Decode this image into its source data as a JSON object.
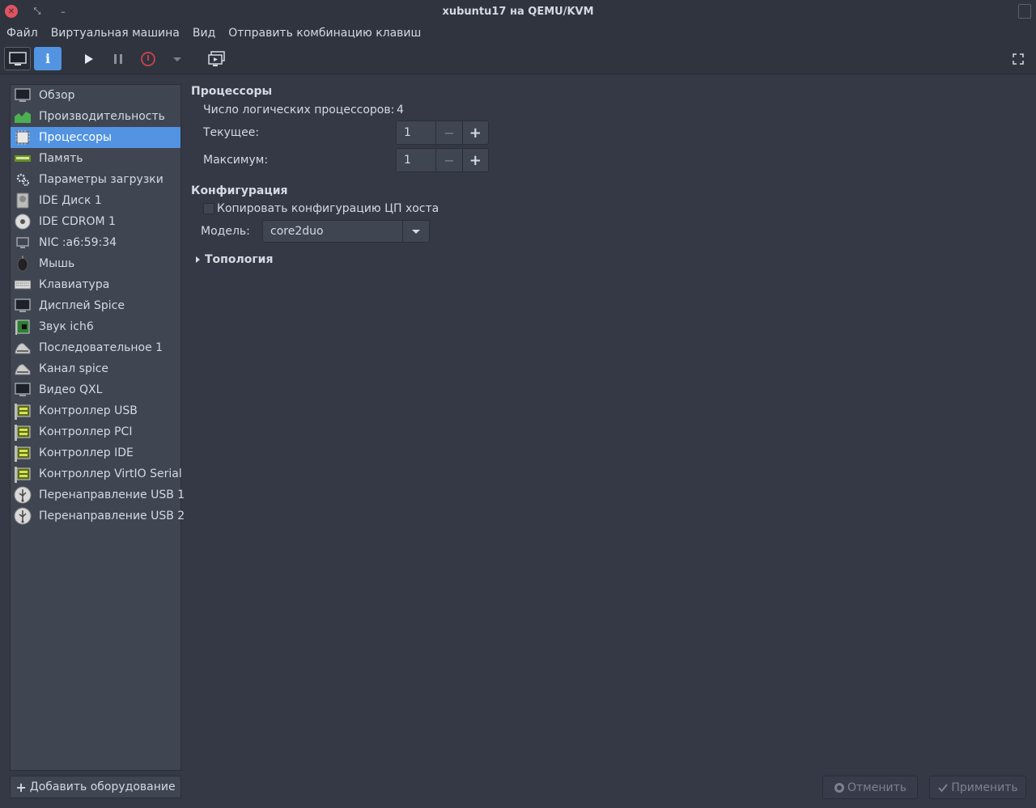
{
  "window": {
    "title": "xubuntu17 на QEMU/KVM"
  },
  "menu": [
    "Файл",
    "Виртуальная машина",
    "Вид",
    "Отправить комбинацию клавиш"
  ],
  "sidebar": {
    "items": [
      {
        "label": "Обзор",
        "icon": "monitor-icon"
      },
      {
        "label": "Производительность",
        "icon": "performance-graph-icon"
      },
      {
        "label": "Процессоры",
        "icon": "cpu-chip-icon",
        "active": true
      },
      {
        "label": "Память",
        "icon": "memory-icon"
      },
      {
        "label": "Параметры загрузки",
        "icon": "gear-icon"
      },
      {
        "label": "IDE Диск 1",
        "icon": "hard-disk-icon"
      },
      {
        "label": "IDE CDROM 1",
        "icon": "cdrom-icon"
      },
      {
        "label": "NIC :a6:59:34",
        "icon": "network-icon"
      },
      {
        "label": "Мышь",
        "icon": "mouse-icon"
      },
      {
        "label": "Клавиатура",
        "icon": "keyboard-icon"
      },
      {
        "label": "Дисплей Spice",
        "icon": "display-icon"
      },
      {
        "label": "Звук ich6",
        "icon": "sound-card-icon"
      },
      {
        "label": "Последовательное 1",
        "icon": "serial-port-icon"
      },
      {
        "label": "Канал spice",
        "icon": "channel-icon"
      },
      {
        "label": "Видео QXL",
        "icon": "video-icon"
      },
      {
        "label": "Контроллер USB",
        "icon": "controller-card-icon"
      },
      {
        "label": "Контроллер PCI",
        "icon": "controller-card-icon"
      },
      {
        "label": "Контроллер IDE",
        "icon": "controller-card-icon"
      },
      {
        "label": "Контроллер VirtIO Serial",
        "icon": "controller-card-icon"
      },
      {
        "label": "Перенаправление USB 1",
        "icon": "usb-icon"
      },
      {
        "label": "Перенаправление USB 2",
        "icon": "usb-icon"
      }
    ],
    "add_button": "Добавить оборудование"
  },
  "cpus": {
    "heading": "Процессоры",
    "logical_label": "Число логических процессоров:",
    "logical_value": "4",
    "current_label": "Текущее:",
    "current_value": "1",
    "max_label": "Максимум:",
    "max_value": "1",
    "minus": "−",
    "plus": "+"
  },
  "config": {
    "heading": "Конфигурация",
    "copy_host_label": "Копировать конфигурацию ЦП хоста",
    "copy_host_checked": false,
    "model_label": "Модель:",
    "model_value": "core2duo"
  },
  "topology": {
    "label": "Топология",
    "expanded": false
  },
  "buttons": {
    "cancel": "Отменить",
    "apply": "Применить"
  },
  "colors": {
    "accent": "#5294e2",
    "bg": "#353945",
    "panel": "#2f343f",
    "close": "#e0535f"
  }
}
